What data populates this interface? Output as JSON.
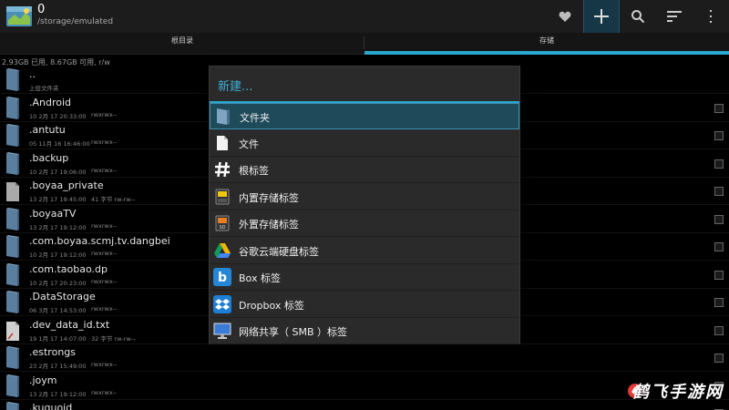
{
  "header": {
    "title": "0",
    "path": "/storage/emulated"
  },
  "tabs": [
    {
      "label": "根目录"
    },
    {
      "label": "存储"
    }
  ],
  "storage_info": "2.93GB 已用, 8.67GB 可用, r/w",
  "files": [
    {
      "name": "..",
      "date": "上层文件夹",
      "perm": "",
      "type": "folder"
    },
    {
      "name": ".Android",
      "date": "10 2月 17 20:33:00",
      "perm": "rwxrwx--",
      "type": "folder"
    },
    {
      "name": ".antutu",
      "date": "05 11月 16 16:46:00",
      "perm": "rwxrwx--",
      "type": "folder"
    },
    {
      "name": ".backup",
      "date": "10 2月 17 19:06:00",
      "perm": "rwxrwx--",
      "type": "folder"
    },
    {
      "name": ".boyaa_private",
      "date": "13 2月 17 19:45:00",
      "perm": "41 字节  rw-rw--",
      "type": "file"
    },
    {
      "name": ".boyaaTV",
      "date": "13 2月 17 19:12:00",
      "perm": "rwxrwx--",
      "type": "folder"
    },
    {
      "name": ".com.boyaa.scmj.tv.dangbei",
      "date": "10 2月 17 19:12:00",
      "perm": "rwxrwx--",
      "type": "folder"
    },
    {
      "name": ".com.taobao.dp",
      "date": "10 2月 17 20:23:00",
      "perm": "rwxrwx--",
      "type": "folder"
    },
    {
      "name": ".DataStorage",
      "date": "06 3月 17 14:53:00",
      "perm": "rwxrwx--",
      "type": "folder"
    },
    {
      "name": ".dev_data_id.txt",
      "date": "19 1月 17 14:07:00",
      "perm": "32 字节  rw-rw--",
      "type": "text"
    },
    {
      "name": ".estrongs",
      "date": "23 2月 17 15:49:00",
      "perm": "rwxrwx--",
      "type": "folder"
    },
    {
      "name": ".joym",
      "date": "13 2月 17 19:12:00",
      "perm": "rwxrwx--",
      "type": "folder"
    },
    {
      "name": ".kuguoid",
      "date": "",
      "perm": "",
      "type": "folder"
    }
  ],
  "dialog": {
    "title": "新建...",
    "items": [
      {
        "label": "文件夹",
        "icon": "folder-icon"
      },
      {
        "label": "文件",
        "icon": "file-icon"
      },
      {
        "label": "根标签",
        "icon": "hash-icon"
      },
      {
        "label": "内置存储标签",
        "icon": "sd-card-icon"
      },
      {
        "label": "外置存储标签",
        "icon": "external-sd-icon"
      },
      {
        "label": "谷歌云端硬盘标签",
        "icon": "google-drive-icon"
      },
      {
        "label": "Box 标签",
        "icon": "box-icon"
      },
      {
        "label": "Dropbox 标签",
        "icon": "dropbox-icon"
      },
      {
        "label": "网络共享（ SMB ）标签",
        "icon": "monitor-icon"
      }
    ]
  },
  "watermark": "鹤飞手游网",
  "colors": {
    "accent": "#2aa7cf",
    "dialog_title": "#3fb1d8",
    "highlight": "#1f4a5a"
  }
}
